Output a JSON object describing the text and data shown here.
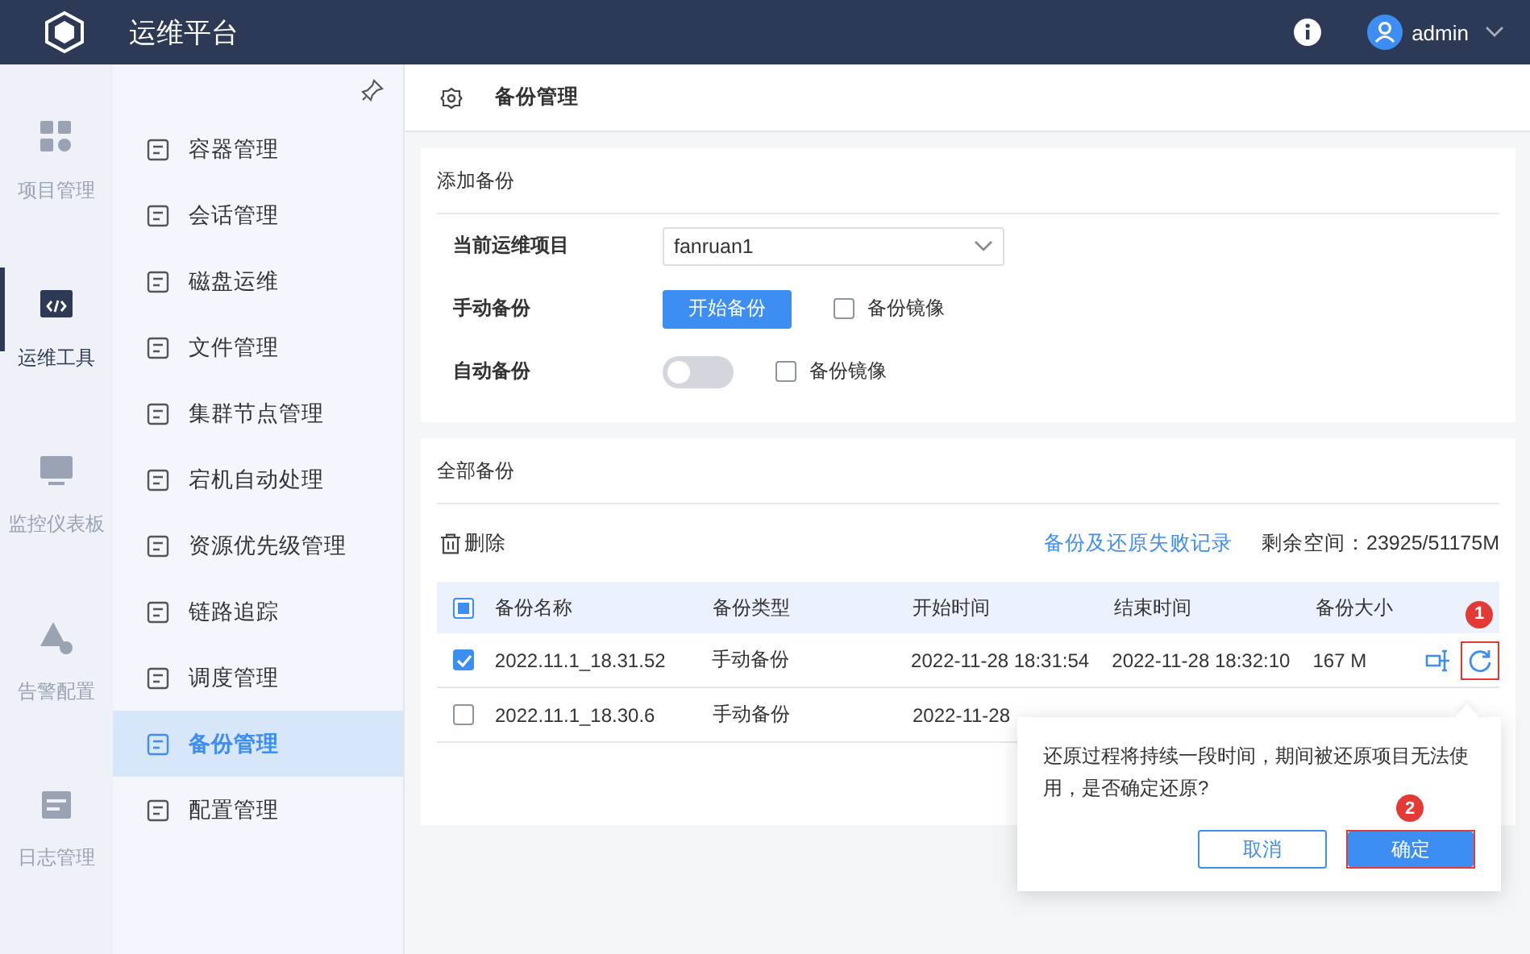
{
  "header": {
    "title": "运维平台",
    "user": "admin"
  },
  "rail": [
    {
      "label": "项目管理",
      "selected": false
    },
    {
      "label": "运维工具",
      "selected": true
    },
    {
      "label": "监控仪表板",
      "selected": false
    },
    {
      "label": "告警配置",
      "selected": false
    },
    {
      "label": "日志管理",
      "selected": false
    }
  ],
  "menu": [
    {
      "label": "容器管理",
      "selected": false
    },
    {
      "label": "会话管理",
      "selected": false
    },
    {
      "label": "磁盘运维",
      "selected": false
    },
    {
      "label": "文件管理",
      "selected": false
    },
    {
      "label": "集群节点管理",
      "selected": false
    },
    {
      "label": "宕机自动处理",
      "selected": false
    },
    {
      "label": "资源优先级管理",
      "selected": false
    },
    {
      "label": "链路追踪",
      "selected": false
    },
    {
      "label": "调度管理",
      "selected": false
    },
    {
      "label": "备份管理",
      "selected": true
    },
    {
      "label": "配置管理",
      "selected": false
    }
  ],
  "page_title": "备份管理",
  "add_backup": {
    "title": "添加备份",
    "project_label": "当前运维项目",
    "project_value": "fanruan1",
    "manual_label": "手动备份",
    "start_button": "开始备份",
    "manual_mirror": {
      "label": "备份镜像",
      "checked": false
    },
    "auto_label": "自动备份",
    "auto_toggle": {
      "on": false
    },
    "auto_mirror": {
      "label": "备份镜像",
      "checked": false
    }
  },
  "all_backups": {
    "title": "全部备份",
    "delete_label": "删除",
    "fail_link": "备份及还原失败记录",
    "space": "剩余空间：23925/51175M",
    "select_all": {
      "partial": true
    },
    "columns": [
      "备份名称",
      "备份类型",
      "开始时间",
      "结束时间",
      "备份大小"
    ],
    "rows": [
      {
        "selected": true,
        "cells": [
          "2022.11.1_18.31.52",
          "手动备份",
          "2022-11-28 18:31:54",
          "2022-11-28 18:32:10",
          "167 M"
        ]
      },
      {
        "selected": false,
        "cells": [
          "2022.11.1_18.30.6",
          "手动备份",
          "2022-11-28"
        ]
      }
    ]
  },
  "popover": {
    "message": "还原过程将持续一段时间，期间被还原项目无法使用，是否确定还原?",
    "cancel": "取消",
    "confirm": "确定"
  },
  "annotations": [
    {
      "number": "1"
    },
    {
      "number": "2"
    }
  ]
}
